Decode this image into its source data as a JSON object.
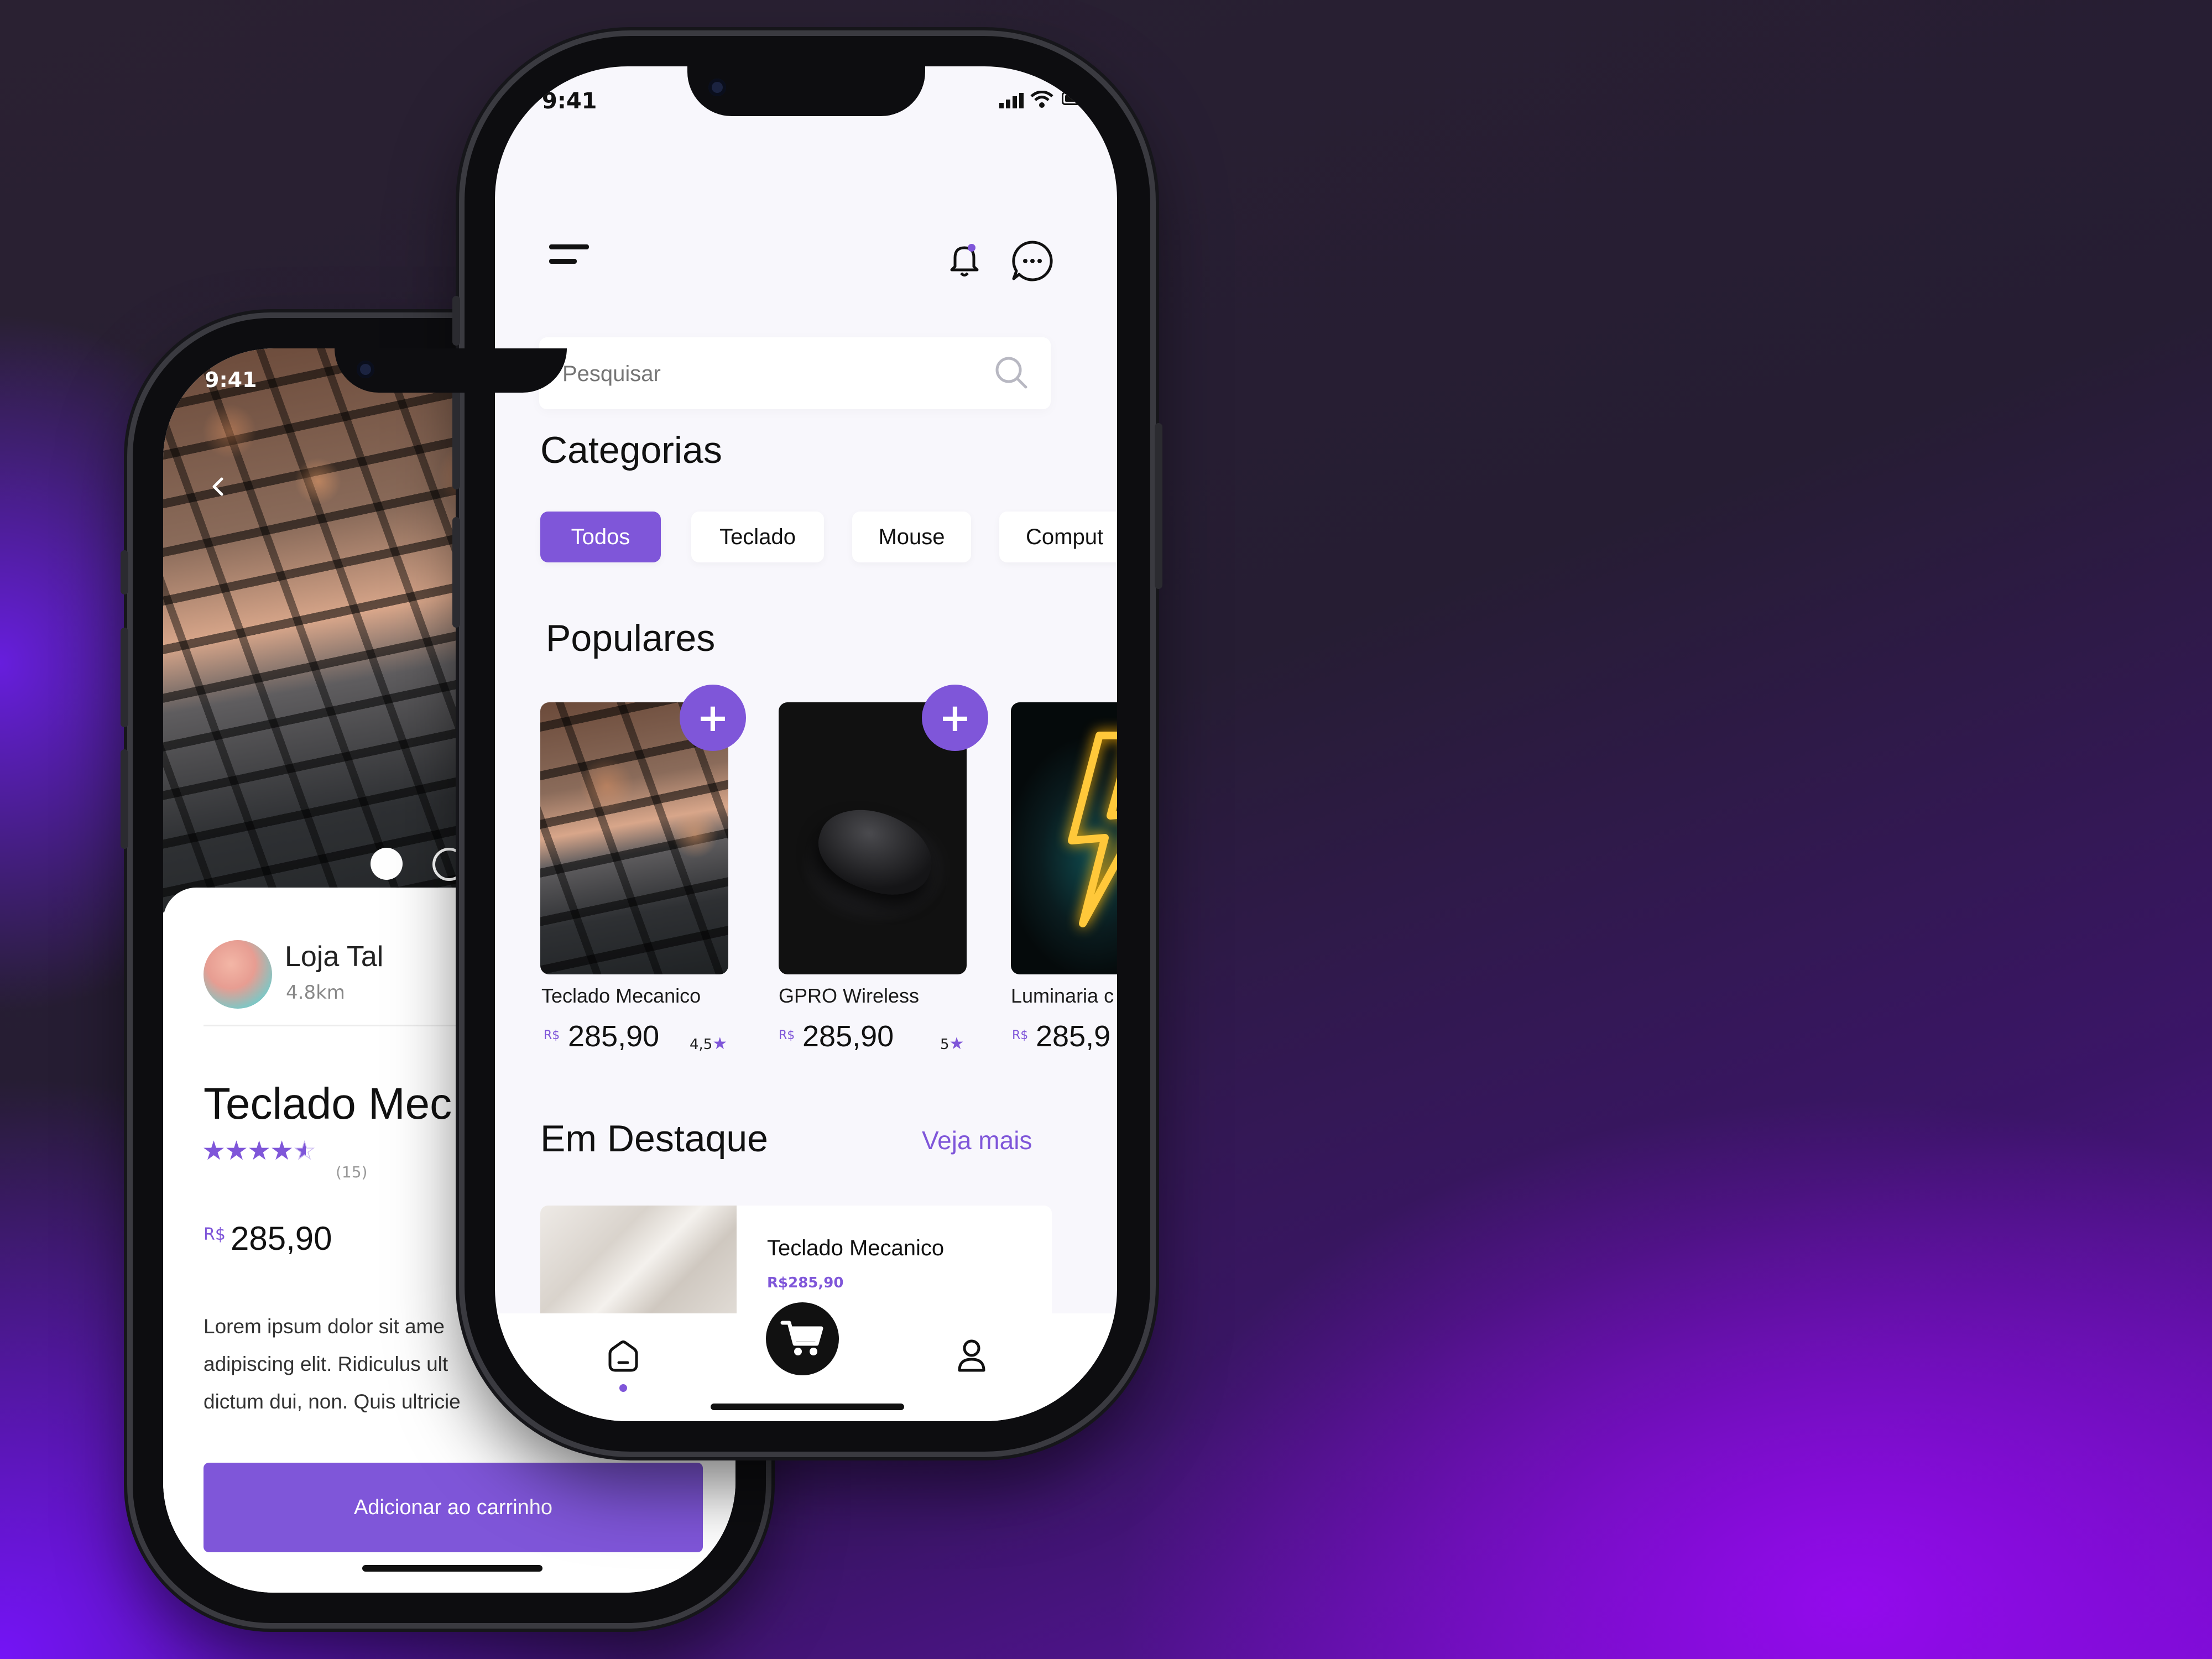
{
  "status_time": "9:41",
  "detail": {
    "carousel_dots": 2,
    "store_name": "Loja Tal",
    "store_distance": "4.8km",
    "product_title": "Teclado Mec",
    "rating_stars": 4.5,
    "review_count": "(15)",
    "currency": "R$",
    "price": "285,90",
    "description": "Lorem ipsum dolor sit ame adipiscing elit. Ridiculus ult dictum dui, non. Quis ultricie",
    "add_to_cart_label": "Adicionar ao carrinho"
  },
  "home": {
    "search_placeholder": "Pesquisar",
    "categories_title": "Categorias",
    "categories": [
      "Todos",
      "Teclado",
      "Mouse",
      "Comput"
    ],
    "active_category": "Todos",
    "popular_title": "Populares",
    "currency": "R$",
    "products": [
      {
        "name": "Teclado Mecanico",
        "price": "285,90",
        "rating": "4,5"
      },
      {
        "name": "GPRO Wireless",
        "price": "285,90",
        "rating": "5"
      },
      {
        "name": "Luminaria c",
        "price": "285,9",
        "rating": ""
      }
    ],
    "featured_title": "Em Destaque",
    "see_more_label": "Veja mais",
    "featured_item": {
      "name": "Teclado Mecanico",
      "price": "R$285,90"
    }
  },
  "colors": {
    "accent": "#7f56d9",
    "dark": "#111111"
  }
}
